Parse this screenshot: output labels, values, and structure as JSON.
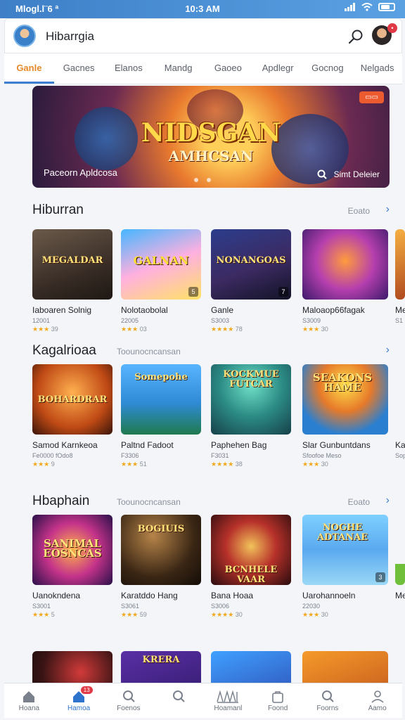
{
  "status": {
    "left": "Mlogl.l¨6 ª",
    "time": "10:3 AM"
  },
  "header": {
    "title": "Hibarrgia"
  },
  "tabs": [
    "Ganle",
    "Gacnes",
    "Elanos",
    "Mandg",
    "Gaoeo",
    "Apdlegr",
    "Gocnog",
    "Nelgads"
  ],
  "banner": {
    "title": "NIDSGAN",
    "subtitle": "AMHCSAN",
    "sticker": "",
    "caption": "Paceorn Apldcosa",
    "cta": "Simt Deleier"
  },
  "sections": [
    {
      "title": "Hiburran",
      "sub": "",
      "more": "Eoato",
      "items": [
        {
          "name": "Iaboaren Solnig",
          "meta": "12001",
          "rating": "39",
          "thumb_text": "MEGALDAR",
          "corner": ""
        },
        {
          "name": "Nolotaobolal",
          "meta": "22005",
          "rating": "03",
          "thumb_text": "GALNAN",
          "corner": "5"
        },
        {
          "name": "Ganle",
          "meta": "S3003",
          "rating": "78",
          "thumb_text": "NONANGOAS",
          "corner": "7"
        },
        {
          "name": "Maloaop66fagak",
          "meta": "S3009",
          "rating": "30",
          "thumb_text": "",
          "corner": ""
        },
        {
          "name": "Me",
          "meta": "S1",
          "rating": "",
          "thumb_text": "",
          "corner": ""
        }
      ]
    },
    {
      "title": "Kagalrioaa",
      "sub": "Toounocncansan",
      "more": "",
      "items": [
        {
          "name": "Samod Karnkeoa",
          "meta": "Fe0000 fOdo8",
          "rating": "9",
          "thumb_text": "BOHARDRAR",
          "corner": ""
        },
        {
          "name": "Paltnd Fadoot",
          "meta": "F3306",
          "rating": "51",
          "thumb_text": "Somepohe",
          "corner": ""
        },
        {
          "name": "Paphehen Bag",
          "meta": "F3031",
          "rating": "38",
          "thumb_text": "KOCKMUE FUTCAR",
          "corner": ""
        },
        {
          "name": "Slar Gunbuntdans",
          "meta": "Sfoofoe Meso",
          "rating": "30",
          "thumb_text": "SEAKONS HAME",
          "corner": ""
        },
        {
          "name": "Ka",
          "meta": "Sop",
          "rating": "",
          "thumb_text": "",
          "corner": ""
        }
      ]
    },
    {
      "title": "Hbaphain",
      "sub": "Toounocncansan",
      "more": "Eoato",
      "items": [
        {
          "name": "Uanokndena",
          "meta": "S3001",
          "rating": "5",
          "thumb_text": "SANIMAL EOSNCAS",
          "corner": ""
        },
        {
          "name": "Karatddo Hang",
          "meta": "S3061",
          "rating": "59",
          "thumb_text": "BOGIUIS",
          "corner": ""
        },
        {
          "name": "Bana Hoaa",
          "meta": "S3006",
          "rating": "30",
          "thumb_text": "BCNHELE VAAR",
          "corner": ""
        },
        {
          "name": "Uarohannoeln",
          "meta": "22030",
          "rating": "30",
          "thumb_text": "NOGHE ADTANAE",
          "corner": "3"
        },
        {
          "name": "Me",
          "meta": "",
          "rating": "",
          "thumb_text": "",
          "corner": ""
        }
      ]
    }
  ],
  "row4": [
    {
      "thumb_text": ""
    },
    {
      "thumb_text": "KRERA"
    },
    {
      "thumb_text": ""
    },
    {
      "thumb_text": ""
    }
  ],
  "bottom_nav": [
    {
      "label": "Hoana",
      "icon": "home-icon"
    },
    {
      "label": "Hamoa",
      "icon": "games-icon",
      "badge": "13"
    },
    {
      "label": "Foenos",
      "icon": "search-icon"
    },
    {
      "label": "",
      "icon": "search-icon"
    },
    {
      "label": "Hoamanl",
      "icon": "library-icon"
    },
    {
      "label": "Foond",
      "icon": "bag-icon"
    },
    {
      "label": "Foorns",
      "icon": "search-icon"
    },
    {
      "label": "Aamo",
      "icon": "profile-icon"
    }
  ],
  "colors": {
    "accent": "#e98a2a",
    "primary": "#2f74cc",
    "badge": "#e03a46",
    "stars": "#f2a81d"
  }
}
